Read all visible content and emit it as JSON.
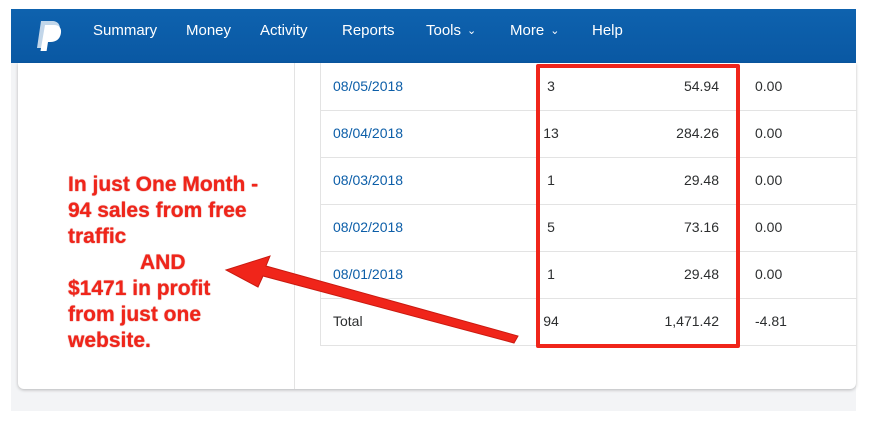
{
  "nav": {
    "items": [
      {
        "label": "Summary",
        "dropdown": false
      },
      {
        "label": "Money",
        "dropdown": false
      },
      {
        "label": "Activity",
        "dropdown": false
      },
      {
        "label": "Reports",
        "dropdown": false
      },
      {
        "label": "Tools",
        "dropdown": true
      },
      {
        "label": "More",
        "dropdown": true
      },
      {
        "label": "Help",
        "dropdown": false
      }
    ],
    "background": "#0b5ea8"
  },
  "table": {
    "rows": [
      {
        "date": "08/05/2018",
        "count": "3",
        "amount": "54.94",
        "fee": "0.00"
      },
      {
        "date": "08/04/2018",
        "count": "13",
        "amount": "284.26",
        "fee": "0.00"
      },
      {
        "date": "08/03/2018",
        "count": "1",
        "amount": "29.48",
        "fee": "0.00"
      },
      {
        "date": "08/02/2018",
        "count": "5",
        "amount": "73.16",
        "fee": "0.00"
      },
      {
        "date": "08/01/2018",
        "count": "1",
        "amount": "29.48",
        "fee": "0.00"
      }
    ],
    "total": {
      "label": "Total",
      "count": "94",
      "amount": "1,471.42",
      "fee": "-4.81"
    }
  },
  "annotation": {
    "lines": [
      "In just One Month -",
      "94 sales from free",
      "traffic",
      "AND",
      "$1471 in profit",
      "from just one",
      "website."
    ],
    "color": "#f0251a"
  },
  "icons": {
    "logo": "paypal-logo-icon",
    "dropdown": "chevron-down-icon",
    "arrow": "arrow-left-icon"
  }
}
